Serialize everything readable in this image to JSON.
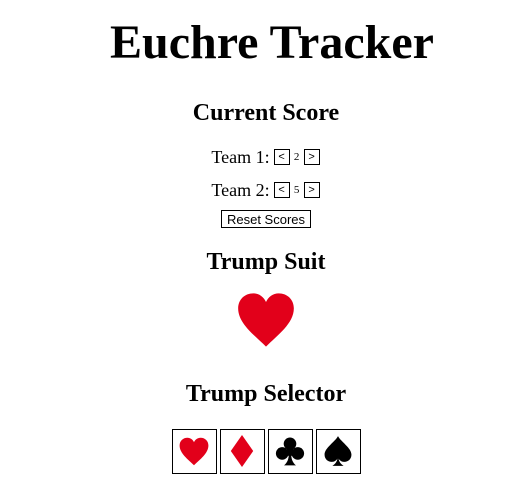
{
  "app": {
    "title": "Euchre Tracker"
  },
  "score": {
    "heading": "Current Score",
    "teams": [
      {
        "label": "Team 1:",
        "decrement": "<",
        "value": "2",
        "increment": ">"
      },
      {
        "label": "Team 2:",
        "decrement": "<",
        "value": "5",
        "increment": ">"
      }
    ],
    "reset_label": "Reset Scores"
  },
  "trump": {
    "heading": "Trump Suit",
    "current_suit": "hearts",
    "current_icon": "heart-icon"
  },
  "selector": {
    "heading": "Trump Selector",
    "suits": [
      {
        "suit": "hearts",
        "icon": "heart-icon",
        "color": "#e2001a"
      },
      {
        "suit": "diamonds",
        "icon": "diamond-icon",
        "color": "#e2001a"
      },
      {
        "suit": "clubs",
        "icon": "club-icon",
        "color": "#000000"
      },
      {
        "suit": "spades",
        "icon": "spade-icon",
        "color": "#000000"
      }
    ]
  },
  "colors": {
    "red_suit": "#e2001a",
    "black_suit": "#000000"
  }
}
